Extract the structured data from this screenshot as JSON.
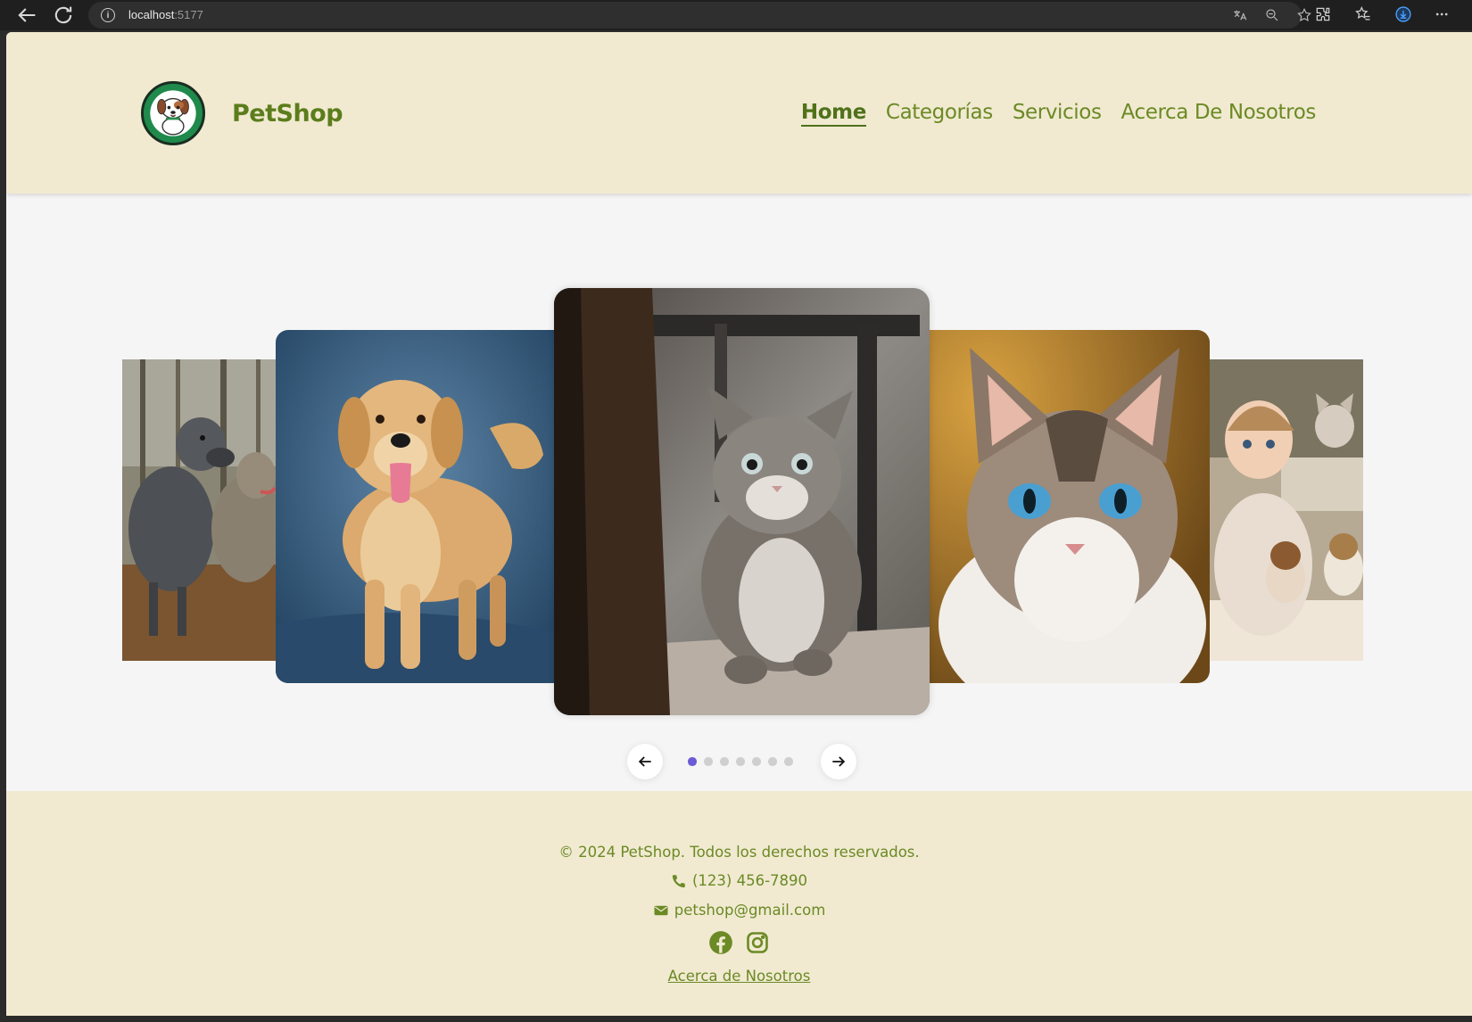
{
  "browser": {
    "url_host": "localhost",
    "url_port": ":5177"
  },
  "header": {
    "brand": "PetShop",
    "nav": [
      {
        "label": "Home",
        "active": true
      },
      {
        "label": "Categorías",
        "active": false
      },
      {
        "label": "Servicios",
        "active": false
      },
      {
        "label": "Acerca De Nosotros",
        "active": false
      }
    ]
  },
  "carousel": {
    "slides": [
      "dogs-great-dane-image",
      "golden-retriever-image",
      "kitten-image",
      "blue-eyed-cat-image",
      "baby-with-kittens-image"
    ],
    "dot_count": 7,
    "active_dot": 1,
    "accent": "#6b5bd6"
  },
  "footer": {
    "copyright": "© 2024 PetShop. Todos los derechos reservados.",
    "phone": "(123) 456-7890",
    "email": "petshop@gmail.com",
    "about_link": "Acerca de Nosotros"
  },
  "colors": {
    "header_bg": "#f1ead1",
    "brand_green": "#5b7d1c",
    "page_bg": "#f5f5f5"
  }
}
